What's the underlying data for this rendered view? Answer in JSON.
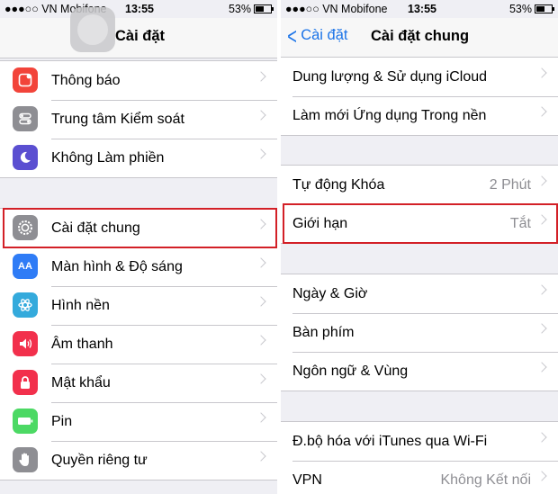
{
  "colors": {
    "highlight": "#d32027",
    "accent": "#1a73e8"
  },
  "left": {
    "status": {
      "carrier": "●●●○○ VN Mobifone",
      "time": "13:55",
      "battery": "53%"
    },
    "title": "Cài đặt",
    "groups": [
      [
        {
          "label": "Thông báo",
          "icon": "notifications-icon",
          "color": "#f2443a"
        },
        {
          "label": "Trung tâm Kiểm soát",
          "icon": "control-center-icon",
          "color": "#8e8e93"
        },
        {
          "label": "Không Làm phiền",
          "icon": "moon-icon",
          "color": "#5b4fd1"
        }
      ],
      [
        {
          "label": "Cài đặt chung",
          "icon": "gear-icon",
          "color": "#8e8e93"
        },
        {
          "label": "Màn hình & Độ sáng",
          "icon": "display-icon",
          "color": "#2f7cf6"
        },
        {
          "label": "Hình nền",
          "icon": "wallpaper-icon",
          "color": "#34aadc"
        },
        {
          "label": "Âm thanh",
          "icon": "sound-icon",
          "color": "#f2304c"
        },
        {
          "label": "Mật khẩu",
          "icon": "lock-icon",
          "color": "#f2304c"
        },
        {
          "label": "Pin",
          "icon": "battery-icon",
          "color": "#4cd964"
        },
        {
          "label": "Quyền riêng tư",
          "icon": "hand-icon",
          "color": "#8e8e93"
        }
      ]
    ]
  },
  "right": {
    "status": {
      "carrier": "●●●○○ VN Mobifone",
      "time": "13:55",
      "battery": "53%"
    },
    "back": "Cài đặt",
    "title": "Cài đặt chung",
    "groups": [
      [
        {
          "label": "Dung lượng & Sử dụng iCloud",
          "value": ""
        },
        {
          "label": "Làm mới Ứng dụng Trong nền",
          "value": ""
        }
      ],
      [
        {
          "label": "Tự động Khóa",
          "value": "2 Phút"
        },
        {
          "label": "Giới hạn",
          "value": "Tắt"
        }
      ],
      [
        {
          "label": "Ngày & Giờ",
          "value": ""
        },
        {
          "label": "Bàn phím",
          "value": ""
        },
        {
          "label": "Ngôn ngữ & Vùng",
          "value": ""
        }
      ],
      [
        {
          "label": "Đ.bộ hóa với iTunes qua Wi-Fi",
          "value": ""
        },
        {
          "label": "VPN",
          "value": "Không Kết nối"
        }
      ]
    ]
  }
}
